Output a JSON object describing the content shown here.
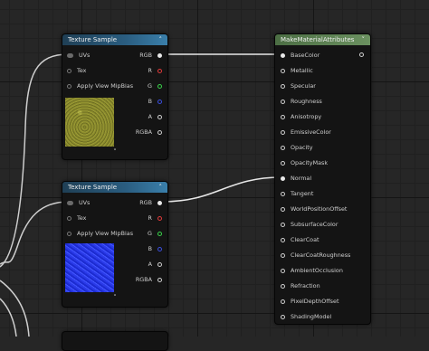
{
  "colors": {
    "background": "#262626",
    "texture_header": "#2a5d80",
    "make_header": "#6b9160",
    "pin_red": "#e23b3b",
    "pin_green": "#39d34a",
    "pin_blue": "#3b4fe0"
  },
  "node_texture_1": {
    "title": "Texture Sample",
    "inputs": [
      "UVs",
      "Tex",
      "Apply View MipBias"
    ],
    "outputs": [
      "RGB",
      "R",
      "G",
      "B",
      "A",
      "RGBA"
    ],
    "preview": "yellow-noise-texture"
  },
  "node_texture_2": {
    "title": "Texture Sample",
    "inputs": [
      "UVs",
      "Tex",
      "Apply View MipBias"
    ],
    "outputs": [
      "RGB",
      "R",
      "G",
      "B",
      "A",
      "RGBA"
    ],
    "preview": "blue-normal-map-texture"
  },
  "node_make": {
    "title": "MakeMaterialAttributes",
    "inputs": [
      "BaseColor",
      "Metallic",
      "Specular",
      "Roughness",
      "Anisotropy",
      "EmissiveColor",
      "Opacity",
      "OpacityMask",
      "Normal",
      "Tangent",
      "WorldPositionOffset",
      "SubsurfaceColor",
      "ClearCoat",
      "ClearCoatRoughness",
      "AmbientOcclusion",
      "Refraction",
      "PixelDepthOffset",
      "ShadingModel"
    ]
  }
}
